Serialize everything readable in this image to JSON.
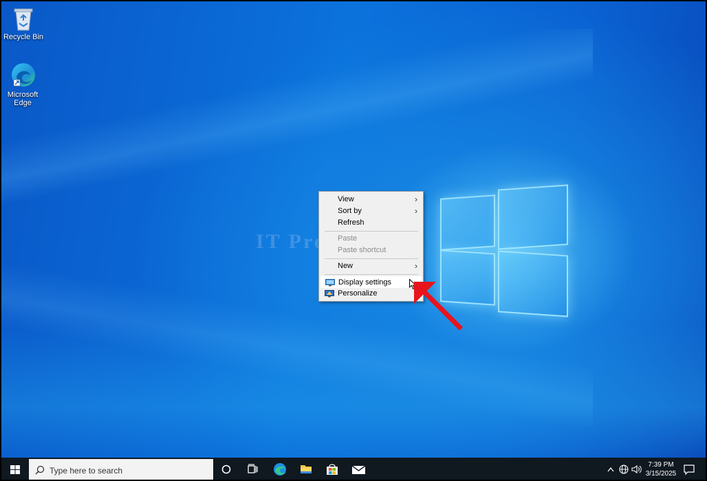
{
  "desktop": {
    "icons": [
      {
        "label": "Recycle Bin"
      },
      {
        "label": "Microsoft Edge"
      }
    ],
    "watermark": "IT Pro HUB"
  },
  "context_menu": {
    "items": [
      {
        "label": "View",
        "has_submenu": true,
        "enabled": true
      },
      {
        "label": "Sort by",
        "has_submenu": true,
        "enabled": true
      },
      {
        "label": "Refresh",
        "has_submenu": false,
        "enabled": true
      },
      {
        "label": "Paste",
        "has_submenu": false,
        "enabled": false
      },
      {
        "label": "Paste shortcut",
        "has_submenu": false,
        "enabled": false
      },
      {
        "label": "New",
        "has_submenu": true,
        "enabled": true
      },
      {
        "label": "Display settings",
        "icon": "monitor-icon",
        "enabled": true,
        "hovered": true
      },
      {
        "label": "Personalize",
        "icon": "personalize-icon",
        "enabled": true
      }
    ]
  },
  "taskbar": {
    "search_placeholder": "Type here to search",
    "clock_time": "7:39 PM",
    "clock_date": "3/15/2025"
  },
  "colors": {
    "accent_arrow": "#e8141c",
    "taskbar_bg": "#101820"
  }
}
